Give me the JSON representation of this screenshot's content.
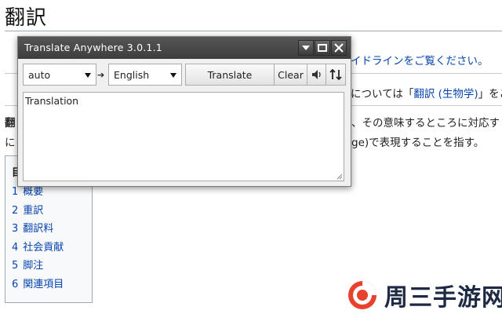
{
  "wiki": {
    "title": "翻訳",
    "line1_tail": "イドラインをご覧ください。",
    "line2_pre": "については「",
    "line2_link": "翻訳 (生物学)",
    "line2_post": "」をご",
    "line3_left": "翻",
    "line3_right": "、その意味するところに対応す",
    "line4_left": "に",
    "line4_right": "ge)で表現することを指す。",
    "toc": {
      "title": "目",
      "items": [
        {
          "num": "1",
          "label": "概要"
        },
        {
          "num": "2",
          "label": "重訳"
        },
        {
          "num": "3",
          "label": "翻訳料"
        },
        {
          "num": "4",
          "label": "社会貢献"
        },
        {
          "num": "5",
          "label": "脚注"
        },
        {
          "num": "6",
          "label": "関連項目"
        }
      ]
    }
  },
  "popup": {
    "title": "Translate Anywhere 3.0.1.1",
    "source_lang": "auto",
    "target_lang": "English",
    "swap_arrow": "➔",
    "translate_label": "Translate",
    "clear_label": "Clear",
    "output_text": "Translation",
    "icons": [
      "minimize-icon",
      "maximize-icon",
      "close-icon",
      "speaker-icon",
      "swap-icon"
    ]
  },
  "watermark": {
    "text": "周三手游网"
  },
  "colors": {
    "link": "#0645ad",
    "titlebar": "#4a4a4a",
    "watermark_red": "#e8412c"
  }
}
